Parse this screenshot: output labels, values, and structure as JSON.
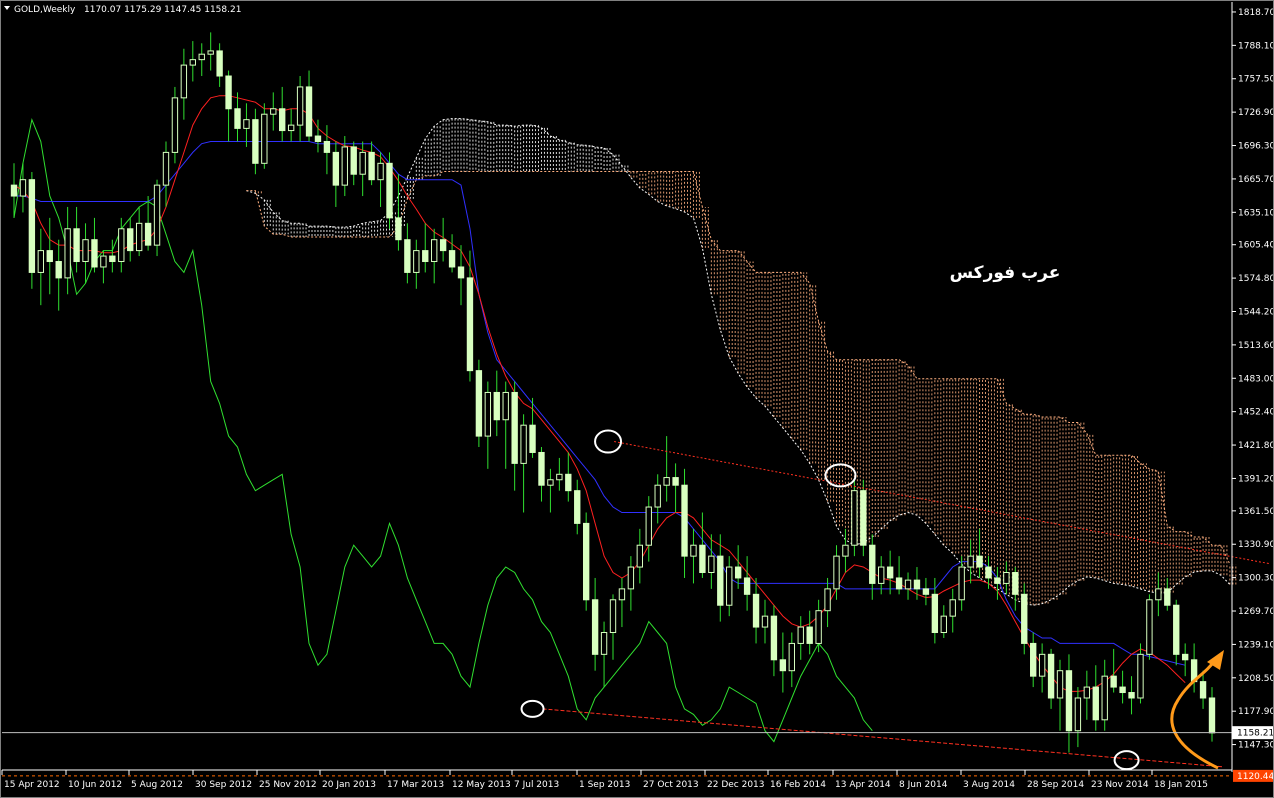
{
  "header": {
    "symbol": "GOLD,Weekly",
    "ohlc": "1170.07 1175.29 1147.45 1158.21"
  },
  "watermark": "عرب فوركس",
  "price_label": "1158.21",
  "support_label": "1120.44",
  "colors": {
    "background": "#000000",
    "bull": "#d8ffc0",
    "bear": "#d8ffc0",
    "tenkan": "#ff2020",
    "kijun": "#3030ff",
    "chikou": "#30e030",
    "cloud_a": "#ffffff",
    "cloud_b": "#ffb080",
    "trendline": "#ff3020",
    "arrow": "#ff9a1a",
    "price_line": "#c0c0c0",
    "support_line": "#ff6a00",
    "support_box": "#ff4400"
  },
  "chart_data": {
    "type": "candlestick",
    "title": "GOLD,Weekly",
    "x_ticks": [
      "15 Apr 2012",
      "10 Jun 2012",
      "5 Aug 2012",
      "30 Sep 2012",
      "25 Nov 2012",
      "20 Jan 2013",
      "17 Mar 2013",
      "12 May 2013",
      "7 Jul 2013",
      "1 Sep 2013",
      "27 Oct 2013",
      "22 Dec 2013",
      "16 Feb 2014",
      "13 Apr 2014",
      "8 Jun 2014",
      "3 Aug 2014",
      "28 Sep 2014",
      "23 Nov 2014",
      "18 Jan 2015"
    ],
    "y_ticks": [
      "1818.70",
      "1788.10",
      "1757.50",
      "1726.90",
      "1696.30",
      "1665.70",
      "1635.10",
      "1605.40",
      "1574.80",
      "1544.20",
      "1513.60",
      "1483.00",
      "1452.40",
      "1421.80",
      "1391.20",
      "1361.50",
      "1330.90",
      "1300.30",
      "1269.70",
      "1239.10",
      "1208.50",
      "1177.90",
      "1147.30"
    ],
    "ylim": [
      1124,
      1826
    ],
    "candles": [
      {
        "o": 1660,
        "h": 1680,
        "l": 1630,
        "c": 1650
      },
      {
        "o": 1650,
        "h": 1680,
        "l": 1635,
        "c": 1665
      },
      {
        "o": 1665,
        "h": 1672,
        "l": 1565,
        "c": 1580
      },
      {
        "o": 1580,
        "h": 1620,
        "l": 1550,
        "c": 1600
      },
      {
        "o": 1600,
        "h": 1630,
        "l": 1560,
        "c": 1590
      },
      {
        "o": 1590,
        "h": 1610,
        "l": 1545,
        "c": 1575
      },
      {
        "o": 1575,
        "h": 1640,
        "l": 1560,
        "c": 1620
      },
      {
        "o": 1620,
        "h": 1640,
        "l": 1580,
        "c": 1590
      },
      {
        "o": 1590,
        "h": 1625,
        "l": 1570,
        "c": 1610
      },
      {
        "o": 1610,
        "h": 1630,
        "l": 1580,
        "c": 1585
      },
      {
        "o": 1585,
        "h": 1600,
        "l": 1570,
        "c": 1595
      },
      {
        "o": 1595,
        "h": 1610,
        "l": 1580,
        "c": 1590
      },
      {
        "o": 1590,
        "h": 1630,
        "l": 1580,
        "c": 1620
      },
      {
        "o": 1620,
        "h": 1630,
        "l": 1590,
        "c": 1600
      },
      {
        "o": 1600,
        "h": 1640,
        "l": 1595,
        "c": 1625
      },
      {
        "o": 1625,
        "h": 1650,
        "l": 1600,
        "c": 1605
      },
      {
        "o": 1605,
        "h": 1665,
        "l": 1595,
        "c": 1660
      },
      {
        "o": 1660,
        "h": 1700,
        "l": 1640,
        "c": 1690
      },
      {
        "o": 1690,
        "h": 1750,
        "l": 1680,
        "c": 1740
      },
      {
        "o": 1740,
        "h": 1785,
        "l": 1720,
        "c": 1770
      },
      {
        "o": 1770,
        "h": 1792,
        "l": 1755,
        "c": 1775
      },
      {
        "o": 1775,
        "h": 1790,
        "l": 1760,
        "c": 1780
      },
      {
        "o": 1780,
        "h": 1800,
        "l": 1765,
        "c": 1783
      },
      {
        "o": 1783,
        "h": 1790,
        "l": 1750,
        "c": 1760
      },
      {
        "o": 1760,
        "h": 1765,
        "l": 1700,
        "c": 1730
      },
      {
        "o": 1730,
        "h": 1745,
        "l": 1700,
        "c": 1712
      },
      {
        "o": 1712,
        "h": 1735,
        "l": 1695,
        "c": 1720
      },
      {
        "o": 1720,
        "h": 1730,
        "l": 1670,
        "c": 1680
      },
      {
        "o": 1680,
        "h": 1735,
        "l": 1675,
        "c": 1725
      },
      {
        "o": 1725,
        "h": 1745,
        "l": 1710,
        "c": 1730
      },
      {
        "o": 1730,
        "h": 1750,
        "l": 1700,
        "c": 1710
      },
      {
        "o": 1710,
        "h": 1730,
        "l": 1700,
        "c": 1715
      },
      {
        "o": 1715,
        "h": 1760,
        "l": 1700,
        "c": 1750
      },
      {
        "o": 1750,
        "h": 1765,
        "l": 1700,
        "c": 1705
      },
      {
        "o": 1705,
        "h": 1720,
        "l": 1690,
        "c": 1700
      },
      {
        "o": 1700,
        "h": 1715,
        "l": 1670,
        "c": 1690
      },
      {
        "o": 1690,
        "h": 1700,
        "l": 1640,
        "c": 1660
      },
      {
        "o": 1660,
        "h": 1705,
        "l": 1650,
        "c": 1695
      },
      {
        "o": 1695,
        "h": 1700,
        "l": 1660,
        "c": 1670
      },
      {
        "o": 1670,
        "h": 1700,
        "l": 1650,
        "c": 1690
      },
      {
        "o": 1690,
        "h": 1700,
        "l": 1660,
        "c": 1665
      },
      {
        "o": 1665,
        "h": 1690,
        "l": 1640,
        "c": 1680
      },
      {
        "o": 1680,
        "h": 1690,
        "l": 1620,
        "c": 1630
      },
      {
        "o": 1630,
        "h": 1670,
        "l": 1600,
        "c": 1610
      },
      {
        "o": 1610,
        "h": 1625,
        "l": 1570,
        "c": 1580
      },
      {
        "o": 1580,
        "h": 1610,
        "l": 1565,
        "c": 1600
      },
      {
        "o": 1600,
        "h": 1625,
        "l": 1580,
        "c": 1590
      },
      {
        "o": 1590,
        "h": 1620,
        "l": 1570,
        "c": 1610
      },
      {
        "o": 1610,
        "h": 1630,
        "l": 1590,
        "c": 1600
      },
      {
        "o": 1600,
        "h": 1615,
        "l": 1580,
        "c": 1585
      },
      {
        "o": 1585,
        "h": 1605,
        "l": 1550,
        "c": 1575
      },
      {
        "o": 1575,
        "h": 1600,
        "l": 1480,
        "c": 1490
      },
      {
        "o": 1490,
        "h": 1500,
        "l": 1420,
        "c": 1430
      },
      {
        "o": 1430,
        "h": 1480,
        "l": 1400,
        "c": 1470
      },
      {
        "o": 1470,
        "h": 1490,
        "l": 1430,
        "c": 1445
      },
      {
        "o": 1445,
        "h": 1480,
        "l": 1400,
        "c": 1470
      },
      {
        "o": 1470,
        "h": 1480,
        "l": 1380,
        "c": 1405
      },
      {
        "o": 1405,
        "h": 1450,
        "l": 1360,
        "c": 1440
      },
      {
        "o": 1440,
        "h": 1465,
        "l": 1410,
        "c": 1415
      },
      {
        "o": 1415,
        "h": 1420,
        "l": 1370,
        "c": 1385
      },
      {
        "o": 1385,
        "h": 1400,
        "l": 1360,
        "c": 1390
      },
      {
        "o": 1390,
        "h": 1410,
        "l": 1380,
        "c": 1395
      },
      {
        "o": 1395,
        "h": 1415,
        "l": 1370,
        "c": 1380
      },
      {
        "o": 1380,
        "h": 1390,
        "l": 1340,
        "c": 1350
      },
      {
        "o": 1350,
        "h": 1360,
        "l": 1270,
        "c": 1280
      },
      {
        "o": 1280,
        "h": 1300,
        "l": 1215,
        "c": 1230
      },
      {
        "o": 1230,
        "h": 1260,
        "l": 1200,
        "c": 1250
      },
      {
        "o": 1250,
        "h": 1285,
        "l": 1225,
        "c": 1280
      },
      {
        "o": 1280,
        "h": 1300,
        "l": 1255,
        "c": 1290
      },
      {
        "o": 1290,
        "h": 1320,
        "l": 1270,
        "c": 1310
      },
      {
        "o": 1310,
        "h": 1345,
        "l": 1295,
        "c": 1330
      },
      {
        "o": 1330,
        "h": 1375,
        "l": 1315,
        "c": 1365
      },
      {
        "o": 1365,
        "h": 1395,
        "l": 1350,
        "c": 1385
      },
      {
        "o": 1385,
        "h": 1430,
        "l": 1370,
        "c": 1392
      },
      {
        "o": 1392,
        "h": 1405,
        "l": 1360,
        "c": 1385
      },
      {
        "o": 1385,
        "h": 1400,
        "l": 1300,
        "c": 1320
      },
      {
        "o": 1320,
        "h": 1345,
        "l": 1295,
        "c": 1330
      },
      {
        "o": 1330,
        "h": 1360,
        "l": 1300,
        "c": 1305
      },
      {
        "o": 1305,
        "h": 1340,
        "l": 1290,
        "c": 1320
      },
      {
        "o": 1320,
        "h": 1340,
        "l": 1260,
        "c": 1275
      },
      {
        "o": 1275,
        "h": 1320,
        "l": 1265,
        "c": 1310
      },
      {
        "o": 1310,
        "h": 1330,
        "l": 1290,
        "c": 1300
      },
      {
        "o": 1300,
        "h": 1320,
        "l": 1270,
        "c": 1285
      },
      {
        "o": 1285,
        "h": 1300,
        "l": 1240,
        "c": 1255
      },
      {
        "o": 1255,
        "h": 1280,
        "l": 1240,
        "c": 1265
      },
      {
        "o": 1265,
        "h": 1275,
        "l": 1210,
        "c": 1225
      },
      {
        "o": 1225,
        "h": 1250,
        "l": 1195,
        "c": 1215
      },
      {
        "o": 1215,
        "h": 1250,
        "l": 1200,
        "c": 1240
      },
      {
        "o": 1240,
        "h": 1265,
        "l": 1225,
        "c": 1255
      },
      {
        "o": 1255,
        "h": 1270,
        "l": 1230,
        "c": 1240
      },
      {
        "o": 1240,
        "h": 1280,
        "l": 1232,
        "c": 1270
      },
      {
        "o": 1270,
        "h": 1300,
        "l": 1255,
        "c": 1290
      },
      {
        "o": 1290,
        "h": 1330,
        "l": 1280,
        "c": 1320
      },
      {
        "o": 1320,
        "h": 1345,
        "l": 1305,
        "c": 1330
      },
      {
        "o": 1330,
        "h": 1390,
        "l": 1320,
        "c": 1380
      },
      {
        "o": 1380,
        "h": 1390,
        "l": 1320,
        "c": 1330
      },
      {
        "o": 1330,
        "h": 1340,
        "l": 1280,
        "c": 1295
      },
      {
        "o": 1295,
        "h": 1320,
        "l": 1285,
        "c": 1310
      },
      {
        "o": 1310,
        "h": 1325,
        "l": 1285,
        "c": 1300
      },
      {
        "o": 1300,
        "h": 1320,
        "l": 1285,
        "c": 1290
      },
      {
        "o": 1290,
        "h": 1305,
        "l": 1280,
        "c": 1298
      },
      {
        "o": 1298,
        "h": 1310,
        "l": 1280,
        "c": 1290
      },
      {
        "o": 1290,
        "h": 1300,
        "l": 1275,
        "c": 1285
      },
      {
        "o": 1285,
        "h": 1300,
        "l": 1240,
        "c": 1250
      },
      {
        "o": 1250,
        "h": 1275,
        "l": 1245,
        "c": 1265
      },
      {
        "o": 1265,
        "h": 1290,
        "l": 1250,
        "c": 1280
      },
      {
        "o": 1280,
        "h": 1320,
        "l": 1270,
        "c": 1310
      },
      {
        "o": 1310,
        "h": 1335,
        "l": 1295,
        "c": 1320
      },
      {
        "o": 1320,
        "h": 1345,
        "l": 1300,
        "c": 1310
      },
      {
        "o": 1310,
        "h": 1320,
        "l": 1290,
        "c": 1300
      },
      {
        "o": 1300,
        "h": 1310,
        "l": 1280,
        "c": 1295
      },
      {
        "o": 1295,
        "h": 1315,
        "l": 1285,
        "c": 1305
      },
      {
        "o": 1305,
        "h": 1310,
        "l": 1270,
        "c": 1285
      },
      {
        "o": 1285,
        "h": 1295,
        "l": 1230,
        "c": 1240
      },
      {
        "o": 1240,
        "h": 1250,
        "l": 1200,
        "c": 1210
      },
      {
        "o": 1210,
        "h": 1240,
        "l": 1195,
        "c": 1230
      },
      {
        "o": 1230,
        "h": 1235,
        "l": 1180,
        "c": 1190
      },
      {
        "o": 1190,
        "h": 1225,
        "l": 1160,
        "c": 1215
      },
      {
        "o": 1215,
        "h": 1230,
        "l": 1140,
        "c": 1160
      },
      {
        "o": 1160,
        "h": 1200,
        "l": 1145,
        "c": 1190
      },
      {
        "o": 1190,
        "h": 1215,
        "l": 1170,
        "c": 1200
      },
      {
        "o": 1200,
        "h": 1220,
        "l": 1160,
        "c": 1170
      },
      {
        "o": 1170,
        "h": 1225,
        "l": 1160,
        "c": 1210
      },
      {
        "o": 1210,
        "h": 1235,
        "l": 1195,
        "c": 1200
      },
      {
        "o": 1200,
        "h": 1215,
        "l": 1185,
        "c": 1195
      },
      {
        "o": 1195,
        "h": 1210,
        "l": 1175,
        "c": 1190
      },
      {
        "o": 1190,
        "h": 1240,
        "l": 1185,
        "c": 1230
      },
      {
        "o": 1230,
        "h": 1285,
        "l": 1225,
        "c": 1280
      },
      {
        "o": 1280,
        "h": 1305,
        "l": 1265,
        "c": 1290
      },
      {
        "o": 1290,
        "h": 1300,
        "l": 1270,
        "c": 1275
      },
      {
        "o": 1275,
        "h": 1280,
        "l": 1220,
        "c": 1230
      },
      {
        "o": 1230,
        "h": 1240,
        "l": 1210,
        "c": 1225
      },
      {
        "o": 1225,
        "h": 1240,
        "l": 1195,
        "c": 1205
      },
      {
        "o": 1205,
        "h": 1215,
        "l": 1180,
        "c": 1190
      },
      {
        "o": 1190,
        "h": 1200,
        "l": 1150,
        "c": 1158
      }
    ],
    "tenkan": [
      1660,
      1655,
      1645,
      1625,
      1610,
      1605,
      1605,
      1600,
      1600,
      1600,
      1598,
      1598,
      1600,
      1605,
      1608,
      1610,
      1620,
      1640,
      1665,
      1690,
      1715,
      1730,
      1740,
      1742,
      1742,
      1740,
      1738,
      1736,
      1730,
      1730,
      1728,
      1730,
      1730,
      1725,
      1712,
      1705,
      1700,
      1696,
      1695,
      1692,
      1690,
      1686,
      1676,
      1664,
      1650,
      1638,
      1625,
      1617,
      1612,
      1606,
      1600,
      1585,
      1560,
      1530,
      1505,
      1485,
      1470,
      1460,
      1455,
      1445,
      1435,
      1425,
      1415,
      1400,
      1380,
      1350,
      1320,
      1305,
      1300,
      1305,
      1315,
      1330,
      1345,
      1355,
      1360,
      1360,
      1355,
      1345,
      1335,
      1330,
      1325,
      1315,
      1305,
      1295,
      1285,
      1275,
      1265,
      1258,
      1255,
      1258,
      1265,
      1275,
      1290,
      1305,
      1312,
      1310,
      1305,
      1300,
      1298,
      1295,
      1290,
      1285,
      1282,
      1283,
      1288,
      1292,
      1296,
      1298,
      1298,
      1295,
      1288,
      1275,
      1260,
      1245,
      1232,
      1220,
      1210,
      1200,
      1196,
      1196,
      1197,
      1200,
      1205,
      1212,
      1222,
      1230,
      1235,
      1232,
      1226,
      1220,
      1212,
      1204
    ],
    "kijun": [
      1650,
      1650,
      1648,
      1645,
      1645,
      1645,
      1645,
      1645,
      1645,
      1645,
      1645,
      1645,
      1645,
      1645,
      1645,
      1645,
      1650,
      1660,
      1670,
      1680,
      1690,
      1698,
      1700,
      1700,
      1700,
      1700,
      1700,
      1700,
      1700,
      1700,
      1700,
      1700,
      1700,
      1700,
      1698,
      1698,
      1698,
      1698,
      1698,
      1698,
      1698,
      1690,
      1680,
      1670,
      1665,
      1665,
      1665,
      1665,
      1665,
      1665,
      1660,
      1620,
      1560,
      1525,
      1500,
      1490,
      1480,
      1470,
      1460,
      1450,
      1440,
      1430,
      1420,
      1410,
      1400,
      1390,
      1375,
      1365,
      1360,
      1360,
      1360,
      1360,
      1360,
      1360,
      1360,
      1355,
      1345,
      1335,
      1325,
      1315,
      1300,
      1295,
      1295,
      1295,
      1295,
      1295,
      1295,
      1295,
      1295,
      1295,
      1295,
      1295,
      1295,
      1290,
      1290,
      1290,
      1290,
      1290,
      1290,
      1290,
      1290,
      1290,
      1290,
      1290,
      1300,
      1310,
      1315,
      1315,
      1315,
      1310,
      1300,
      1280,
      1265,
      1255,
      1250,
      1245,
      1245,
      1240,
      1240,
      1240,
      1240,
      1240,
      1240,
      1240,
      1235,
      1230,
      1230,
      1228,
      1226,
      1224,
      1222,
      1220
    ],
    "chikou": [
      1630,
      1680,
      1720,
      1700,
      1650,
      1630,
      1600,
      1560,
      1570,
      1590,
      1600,
      1600,
      1620,
      1630,
      1640,
      1645,
      1640,
      1615,
      1590,
      1580,
      1600,
      1550,
      1480,
      1460,
      1430,
      1420,
      1395,
      1380,
      1385,
      1390,
      1395,
      1340,
      1310,
      1240,
      1220,
      1230,
      1270,
      1310,
      1330,
      1320,
      1310,
      1320,
      1350,
      1330,
      1300,
      1280,
      1260,
      1240,
      1240,
      1230,
      1210,
      1200,
      1240,
      1275,
      1300,
      1310,
      1305,
      1290,
      1280,
      1260,
      1250,
      1230,
      1210,
      1180,
      1170,
      1190,
      1200,
      1210,
      1220,
      1230,
      1240,
      1260,
      1250,
      1240,
      1200,
      1180,
      1175,
      1165,
      1170,
      1180,
      1200,
      1195,
      1190,
      1185,
      1160,
      1150,
      1170,
      1190,
      1210,
      1225,
      1240,
      1230,
      1210,
      1200,
      1190,
      1170,
      1160
    ]
  }
}
